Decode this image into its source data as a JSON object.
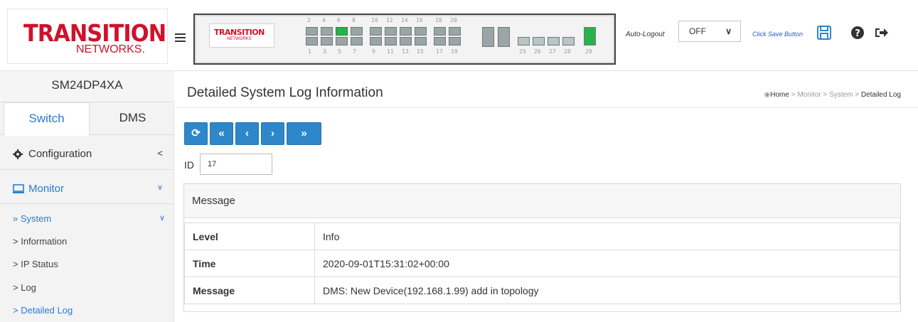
{
  "header": {
    "logo_main": "TRANSITION",
    "logo_sub": "NETWORKS.",
    "mini_logo_main": "TRANSITION",
    "mini_logo_sub": "NETWORKS",
    "autologout_label": "Auto-Logout",
    "autologout_value": "OFF",
    "save_link": "Click Save Button",
    "icons": [
      "menu-icon",
      "save-icon",
      "help-icon",
      "logout-icon"
    ]
  },
  "switch_panel": {
    "top_port_numbers": [
      "2",
      "4",
      "6",
      "8",
      "10",
      "12",
      "14",
      "16",
      "18",
      "20"
    ],
    "bottom_port_numbers": [
      "1",
      "3",
      "5",
      "7",
      "9",
      "11",
      "13",
      "15",
      "17",
      "19"
    ],
    "right_port_numbers": [
      "25",
      "26",
      "27",
      "28",
      "29"
    ],
    "active_ports": [
      "6",
      "29"
    ]
  },
  "sidebar": {
    "device_name": "SM24DP4XA",
    "tabs": [
      "Switch",
      "DMS"
    ],
    "active_tab": "Switch",
    "menu": [
      {
        "label": "Configuration",
        "icon": "gear-icon",
        "arrow": "<"
      },
      {
        "label": "Monitor",
        "icon": "monitor-icon",
        "arrow": "v"
      }
    ],
    "system_label": "» System",
    "system_items": [
      {
        "label": "> Information"
      },
      {
        "label": "> IP Status"
      },
      {
        "label": "> Log"
      },
      {
        "label": "> Detailed Log"
      }
    ]
  },
  "main": {
    "title": "Detailed System Log Information",
    "breadcrumb": {
      "home": "Home",
      "sep": ">",
      "monitor": "Monitor",
      "system": "System",
      "current": "Detailed Log"
    },
    "toolbar": {
      "refresh": "⟳",
      "first": "«",
      "prev": "‹",
      "next": "›",
      "last": "»"
    },
    "id_label": "ID",
    "id_value": "17",
    "panel_title": "Message",
    "rows": [
      {
        "key": "Level",
        "value": "Info"
      },
      {
        "key": "Time",
        "value": "2020-09-01T15:31:02+00:00"
      },
      {
        "key": "Message",
        "value": "DMS: New Device(192.168.1.99) add in topology"
      }
    ]
  },
  "colors": {
    "accent": "#2a7bd1",
    "button": "#2e87c8",
    "brand_red": "#d0112b",
    "port_up": "#28b24a"
  }
}
